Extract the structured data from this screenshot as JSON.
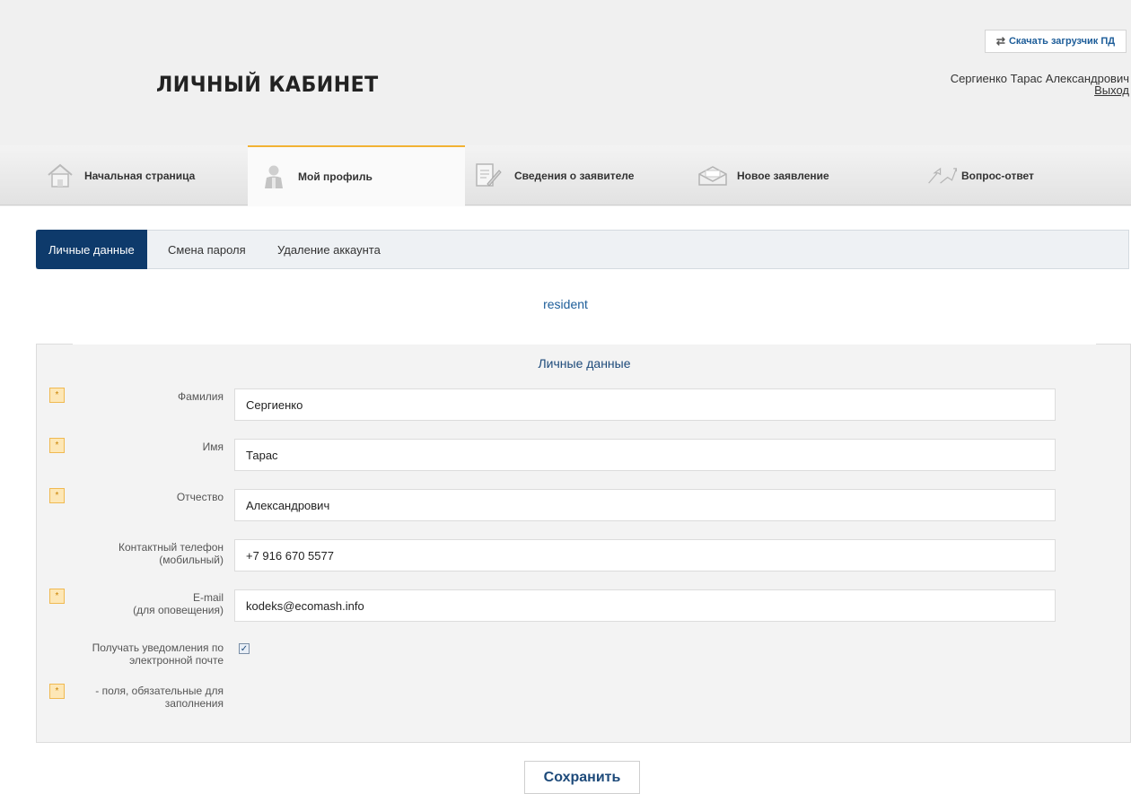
{
  "header": {
    "title": "ЛИЧНЫЙ КАБИНЕТ",
    "download_label": "Скачать загрузчик ПД",
    "user_name": "Сергиенко Тарас Александрович",
    "logout": "Выход"
  },
  "nav": {
    "items": [
      {
        "label": "Начальная страница",
        "icon": "home-icon"
      },
      {
        "label": "Мой профиль",
        "icon": "user-icon"
      },
      {
        "label": "Сведения о заявителе",
        "icon": "document-edit-icon"
      },
      {
        "label": "Новое заявление",
        "icon": "envelope-icon"
      },
      {
        "label": "Вопрос-ответ",
        "icon": "question-answer-icon"
      }
    ],
    "active": "Мой профиль"
  },
  "subtabs": [
    "Личные данные",
    "Смена пароля",
    "Удаление аккаунта"
  ],
  "active_subtab": "Личные данные",
  "login": "resident",
  "form": {
    "title": "Личные данные",
    "required_mark": "*",
    "fields": {
      "surname": {
        "label": "Фамилия",
        "value": "Сергиенко",
        "required": true
      },
      "name": {
        "label": "Имя",
        "value": "Тарас",
        "required": true
      },
      "patronymic": {
        "label": "Отчество",
        "value": "Александрович",
        "required": true
      },
      "phone": {
        "label_line1": "Контактный телефон",
        "label_line2": "(мобильный)",
        "value": "+7 916 670 5577",
        "required": false
      },
      "email": {
        "label_line1": "E-mail",
        "label_line2": "(для оповещения)",
        "value": "kodeks@ecomash.info",
        "required": true
      }
    },
    "notify": {
      "label_line1": "Получать уведомления по",
      "label_line2": "электронной почте",
      "checked": true
    },
    "legend": {
      "line1": "- поля, обязательные для",
      "line2": "заполнения"
    }
  },
  "save_label": "Сохранить",
  "colors": {
    "accent": "#0e3a6b",
    "link": "#1d5d99",
    "active_tab_border": "#f2b233",
    "required_bg": "#fde7b6"
  }
}
